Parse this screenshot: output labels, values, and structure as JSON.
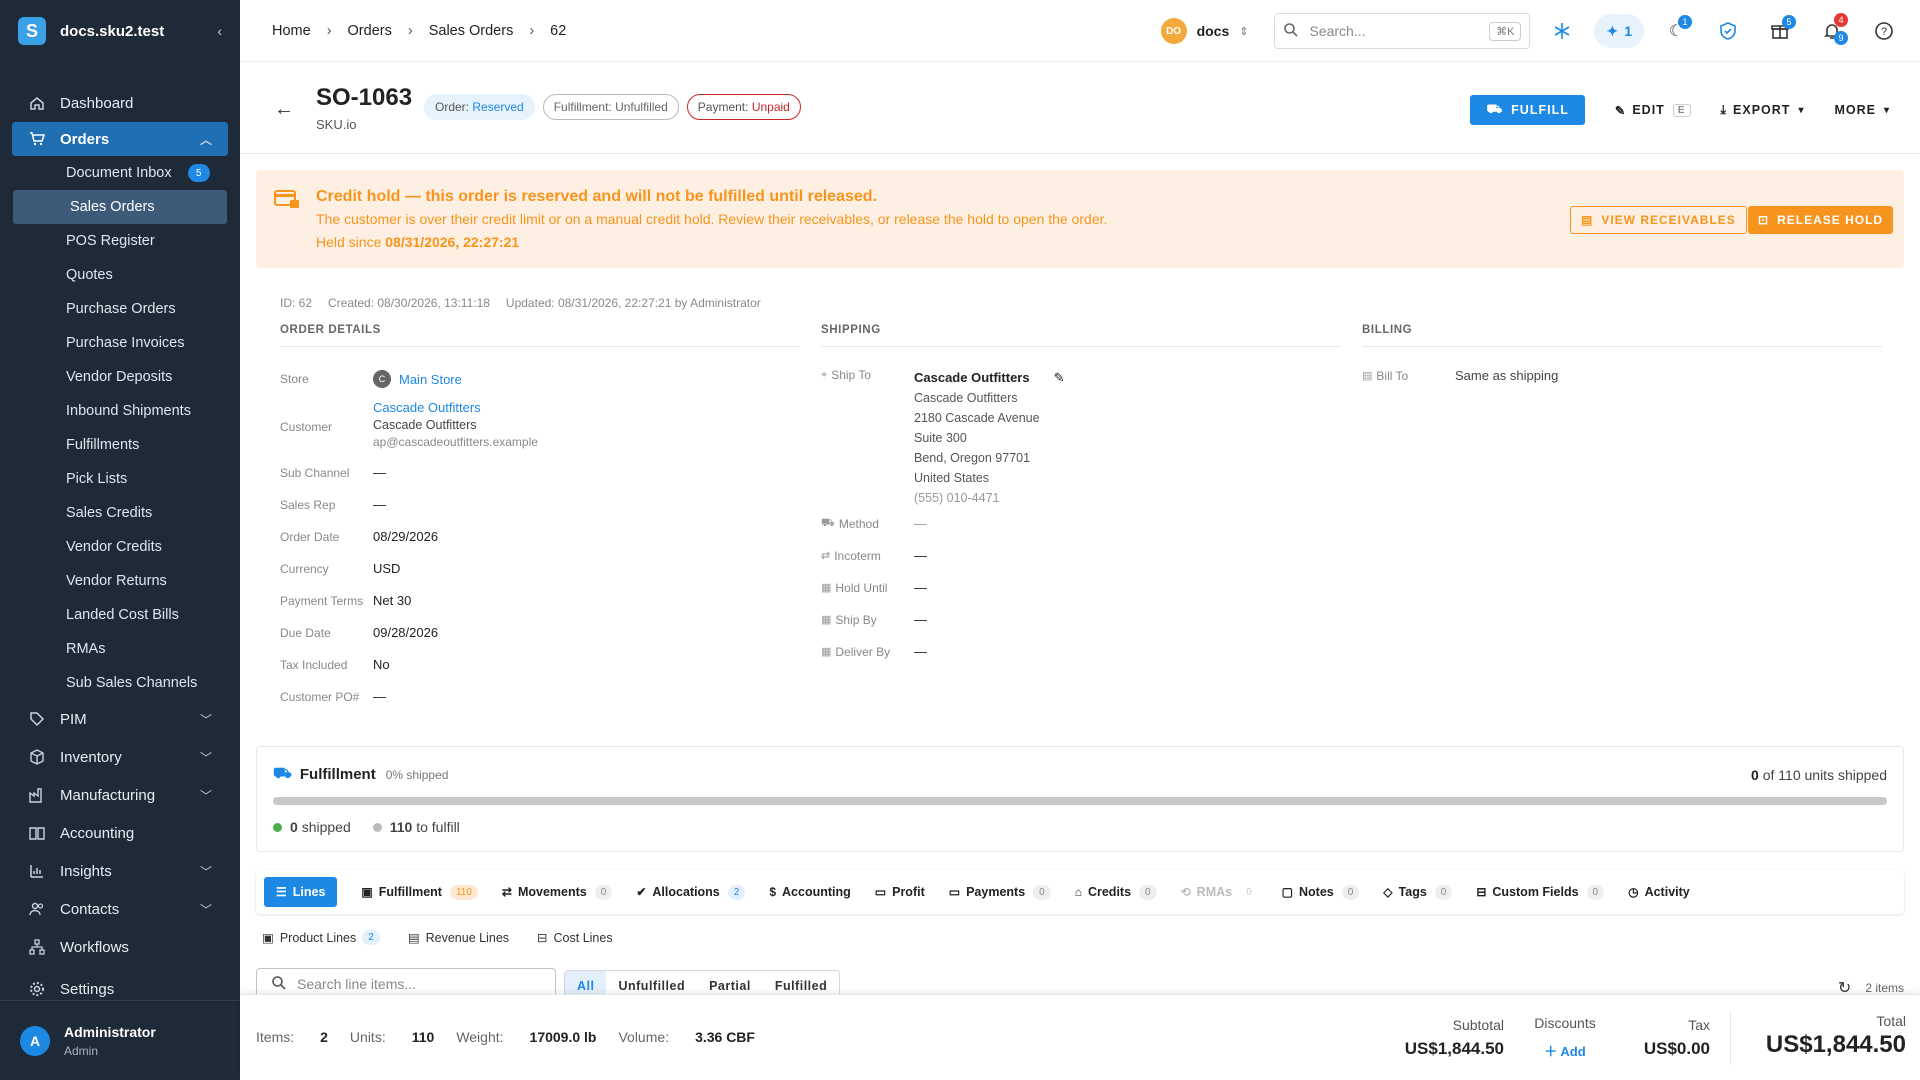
{
  "sidebar": {
    "workspace": "docs.sku2.test",
    "collapse_glyph": "‹",
    "nav": {
      "dashboard": "Dashboard",
      "orders": "Orders",
      "pim": "PIM",
      "inventory": "Inventory",
      "manufacturing": "Manufacturing",
      "accounting": "Accounting",
      "insights": "Insights",
      "contacts": "Contacts",
      "workflows": "Workflows",
      "settings": "Settings"
    },
    "orders_sub": [
      {
        "label": "Document Inbox",
        "badge": "5"
      },
      {
        "label": "Sales Orders"
      },
      {
        "label": "POS Register"
      },
      {
        "label": "Quotes"
      },
      {
        "label": "Purchase Orders"
      },
      {
        "label": "Purchase Invoices"
      },
      {
        "label": "Vendor Deposits"
      },
      {
        "label": "Inbound Shipments"
      },
      {
        "label": "Fulfillments"
      },
      {
        "label": "Pick Lists"
      },
      {
        "label": "Sales Credits"
      },
      {
        "label": "Vendor Credits"
      },
      {
        "label": "Vendor Returns"
      },
      {
        "label": "Landed Cost Bills"
      },
      {
        "label": "RMAs"
      },
      {
        "label": "Sub Sales Channels"
      }
    ],
    "user": {
      "initial": "A",
      "name": "Administrator",
      "role": "Admin"
    }
  },
  "topbar": {
    "breadcrumb": [
      "Home",
      "Orders",
      "Sales Orders",
      "62"
    ],
    "workspace_initials": "DO",
    "workspace_name": "docs",
    "search_placeholder": "Search...",
    "search_shortcut": "⌘K",
    "ai_count": "1",
    "badges": {
      "moon": "1",
      "gift": "5",
      "bell_top": "4",
      "bell_bottom": "9"
    }
  },
  "header": {
    "title": "SO-1063",
    "subtitle": "SKU.io",
    "chips": [
      {
        "key": "Order:",
        "value": "Reserved"
      },
      {
        "key": "Fulfillment:",
        "value": "Unfulfilled"
      },
      {
        "key": "Payment:",
        "value": "Unpaid"
      }
    ],
    "actions": {
      "fulfill": "FULFILL",
      "edit": "EDIT",
      "edit_shortcut": "E",
      "export": "EXPORT",
      "more": "MORE"
    }
  },
  "alert": {
    "title": "Credit hold — this order is reserved and will not be fulfilled until released.",
    "text": "The customer is over their credit limit or on a manual credit hold. Review their receivables, or release the hold to open the order.",
    "since_label": "Held since",
    "since_value": "08/31/2026, 22:27:21",
    "btn_receivables": "VIEW RECEIVABLES",
    "btn_release": "RELEASE HOLD"
  },
  "meta": {
    "id": "ID: 62",
    "created": "Created: 08/30/2026, 13:11:18",
    "updated": "Updated: 08/31/2026, 22:27:21 by Administrator"
  },
  "order_details": {
    "heading": "ORDER DETAILS",
    "store_label": "Store",
    "store_initial": "C",
    "store_value": "Main Store",
    "customer_label": "Customer",
    "customer_link": "Cascade Outfitters",
    "customer_name": "Cascade Outfitters",
    "customer_email": "ap@cascadeoutfitters.example",
    "subchannel_label": "Sub Channel",
    "subchannel_value": "—",
    "salesrep_label": "Sales Rep",
    "salesrep_value": "—",
    "orderdate_label": "Order Date",
    "orderdate_value": "08/29/2026",
    "currency_label": "Currency",
    "currency_value": "USD",
    "terms_label": "Payment Terms",
    "terms_value": "Net 30",
    "duedate_label": "Due Date",
    "duedate_value": "09/28/2026",
    "tax_label": "Tax Included",
    "tax_value": "No",
    "po_label": "Customer PO#",
    "po_value": "—"
  },
  "shipping": {
    "heading": "SHIPPING",
    "shipto_label": "Ship To",
    "name": "Cascade Outfitters",
    "lines": [
      "Cascade Outfitters",
      "2180 Cascade Avenue",
      "Suite 300",
      "Bend, Oregon 97701",
      "United States",
      "(555) 010-4471"
    ],
    "method_label": "Method",
    "method_value": "—",
    "incoterm_label": "Incoterm",
    "incoterm_value": "—",
    "holduntil_label": "Hold Until",
    "holduntil_value": "—",
    "shipby_label": "Ship By",
    "shipby_value": "—",
    "deliverby_label": "Deliver By",
    "deliverby_value": "—"
  },
  "billing": {
    "heading": "BILLING",
    "billto_label": "Bill To",
    "billto_value": "Same as shipping"
  },
  "fulfillment": {
    "title": "Fulfillment",
    "pct_label": "0% shipped",
    "shipped_fraction": 0,
    "units_shipped": "0",
    "units_text": "of 110 units shipped",
    "shipped_count": "0",
    "shipped_label": "shipped",
    "to_fulfill_count": "110",
    "to_fulfill_label": "to fulfill"
  },
  "tabs": [
    {
      "label": "Lines"
    },
    {
      "label": "Fulfillment",
      "count": "110"
    },
    {
      "label": "Movements",
      "count": "0"
    },
    {
      "label": "Allocations",
      "count": "2"
    },
    {
      "label": "Accounting"
    },
    {
      "label": "Profit"
    },
    {
      "label": "Payments",
      "count": "0"
    },
    {
      "label": "Credits",
      "count": "0"
    },
    {
      "label": "RMAs",
      "count": "0"
    },
    {
      "label": "Notes",
      "count": "0"
    },
    {
      "label": "Tags",
      "count": "0"
    },
    {
      "label": "Custom Fields",
      "count": "0"
    },
    {
      "label": "Activity"
    }
  ],
  "subtabs": [
    {
      "label": "Product Lines",
      "count": "2"
    },
    {
      "label": "Revenue Lines"
    },
    {
      "label": "Cost Lines"
    }
  ],
  "lines_toolbar": {
    "search_placeholder": "Search line items...",
    "filters": [
      "All",
      "Unfulfilled",
      "Partial",
      "Fulfilled"
    ],
    "count": "2 items"
  },
  "footer": {
    "items_label": "Items:",
    "items_value": "2",
    "units_label": "Units:",
    "units_value": "110",
    "weight_label": "Weight:",
    "weight_value": "17009.0 lb",
    "volume_label": "Volume:",
    "volume_value": "3.36 CBF",
    "subtotal_label": "Subtotal",
    "subtotal_value": "US$1,844.50",
    "discounts_label": "Discounts",
    "discounts_add": "Add",
    "tax_label": "Tax",
    "tax_value": "US$0.00",
    "total_label": "Total",
    "total_value": "US$1,844.50"
  },
  "colors": {
    "accent": "#1e88e5",
    "warning": "#f7941d",
    "danger": "#c62828",
    "sidebar": "#1e2a38"
  }
}
